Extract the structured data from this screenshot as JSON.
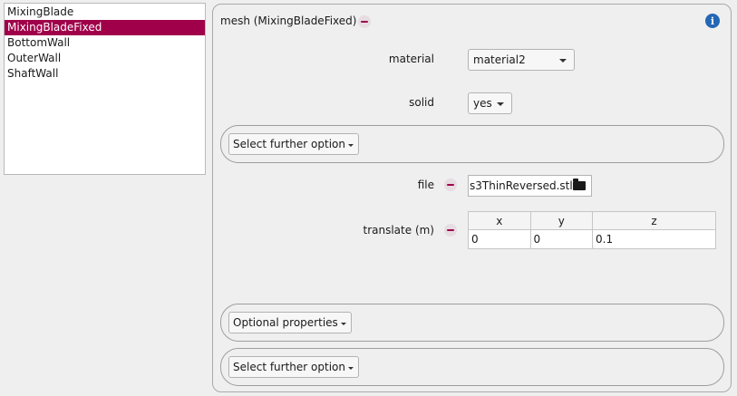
{
  "object_list": [
    "MixingBlade",
    "MixingBladeFixed",
    "BottomWall",
    "OuterWall",
    "ShaftWall"
  ],
  "selected_index": 1,
  "panel": {
    "title": "mesh (MixingBladeFixed)",
    "material_label": "material",
    "material_value": "material2",
    "solid_label": "solid",
    "solid_value": "yes",
    "further_option_label": "Select further option",
    "file_label": "file",
    "file_value": "s3ThinReversed.stl",
    "translate_label": "translate (m)",
    "translate_headers": [
      "x",
      "y",
      "z"
    ],
    "translate_values": [
      "0",
      "0",
      "0.1"
    ],
    "optional_label": "Optional properties",
    "further_option_label_2": "Select further option"
  },
  "icons": {
    "remove": "minus-circle-icon",
    "info": "info-icon",
    "folder": "folder-icon",
    "dropdown": "chevron-down-icon"
  },
  "colors": {
    "selection": "#a0004a",
    "info": "#2467b5"
  }
}
